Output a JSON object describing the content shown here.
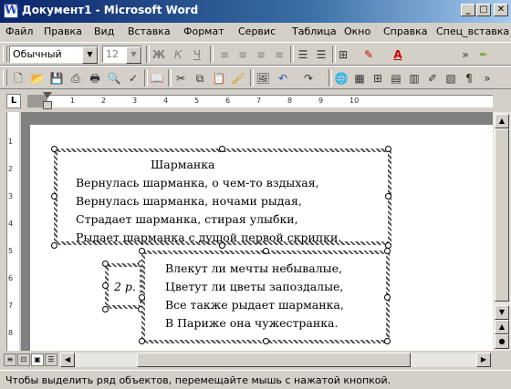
{
  "window": {
    "title": "Документ1 - Microsoft Word",
    "icon_letter": "W",
    "controls": [
      "minimize-icon",
      "maximize-icon",
      "close-icon"
    ]
  },
  "menu": {
    "items": [
      "Файл",
      "Правка",
      "Вид",
      "Вставка",
      "Формат",
      "Сервис",
      "Таблица",
      "Окно",
      "Справка",
      "Спец_вставка"
    ]
  },
  "formatting_toolbar": {
    "style_value": "Обычный",
    "size_value": "12",
    "bold": "Ж",
    "italic": "К",
    "underline": "Ч",
    "font_color_letter": "A"
  },
  "ruler": {
    "tab_marker": "L",
    "numbers": [
      "1",
      "2",
      "3",
      "4",
      "5",
      "6",
      "7",
      "8",
      "9",
      "10"
    ]
  },
  "vruler": {
    "numbers": [
      "1",
      "2",
      "3",
      "4",
      "5",
      "6",
      "7",
      "8"
    ]
  },
  "document": {
    "upper_frame": {
      "lines": [
        "Шарманка",
        "Вернулась шарманка, о чем-то вздыхая,",
        "Вернулась шарманка, ночами рыдая,",
        "Страдает шарманка, стирая улыбки,",
        "Рыдает шарманка с душой первой скрипки."
      ]
    },
    "label_frame": {
      "text": "2 р."
    },
    "lower_frame": {
      "lines": [
        "Влекут ли мечты небывалые,",
        "Цветут ли цветы запоздалые,",
        "Все также рыдает шарманка,",
        "В Париже она чужестранка."
      ]
    }
  },
  "status_bar": {
    "text": "Чтобы выделить ряд объектов, перемещайте мышь с нажатой кнопкой."
  }
}
